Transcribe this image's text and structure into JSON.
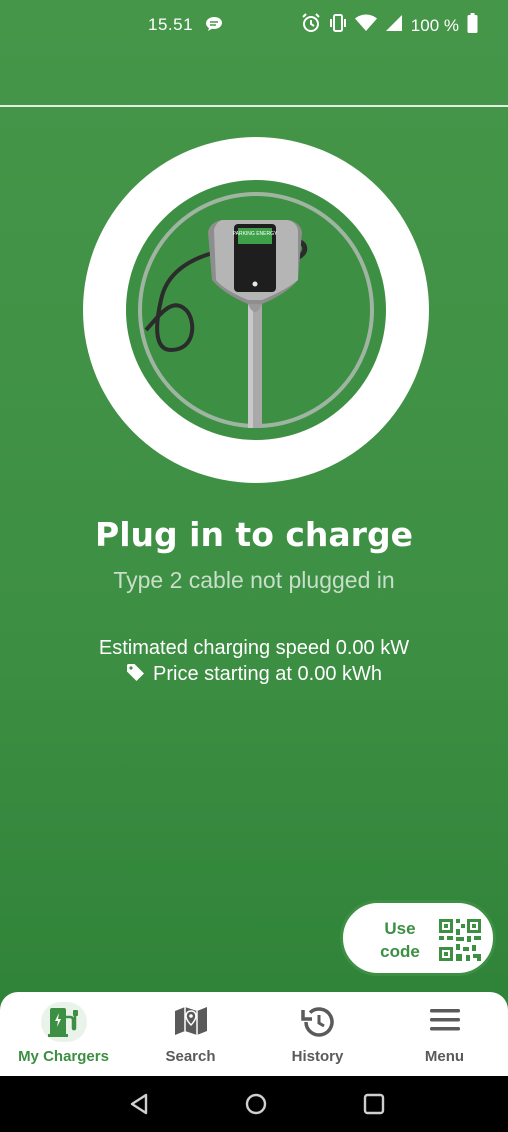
{
  "status_bar": {
    "time": "15.51",
    "battery_text": "100 %",
    "icons": [
      "chat-bubble-icon",
      "alarm-icon",
      "vibrate-icon",
      "wifi-icon",
      "signal-icon",
      "battery-icon"
    ]
  },
  "main": {
    "title": "Plug in to charge",
    "subtitle": "Type 2 cable not plugged in",
    "speed_label": "Estimated charging speed ",
    "speed_value": "0.00 kW",
    "price_label": "Price starting at ",
    "price_value": "0.00 kWh",
    "charger_brand_text": "PARKING ENERGY"
  },
  "use_code": {
    "line1": "Use",
    "line2": "code"
  },
  "bottom_nav": {
    "items": [
      {
        "label": "My Chargers",
        "icon": "ev-station-icon",
        "active": true
      },
      {
        "label": "Search",
        "icon": "map-icon",
        "active": false
      },
      {
        "label": "History",
        "icon": "history-icon",
        "active": false
      },
      {
        "label": "Menu",
        "icon": "hamburger-menu-icon",
        "active": false
      }
    ]
  },
  "colors": {
    "primary_green": "#3d8f43",
    "background_green": "#46964a",
    "white": "#ffffff",
    "inactive_nav": "#5a5a5a"
  }
}
